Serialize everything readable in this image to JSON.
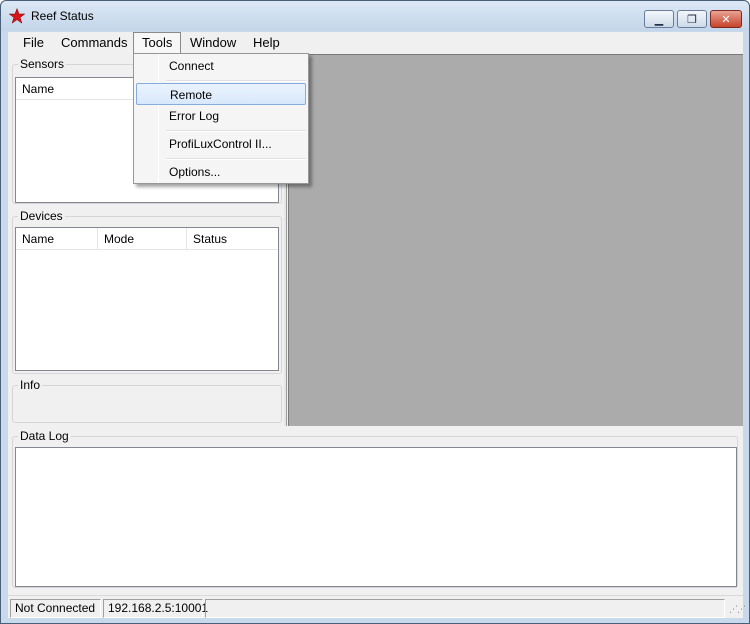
{
  "window": {
    "title": "Reef Status",
    "minimize_glyph": "▁",
    "maximize_glyph": "❐",
    "close_glyph": "✕",
    "icon": "red-star-icon",
    "icon_color": "#d7141a"
  },
  "menubar": {
    "items": [
      {
        "label": "File"
      },
      {
        "label": "Commands"
      },
      {
        "label": "Tools"
      },
      {
        "label": "Window"
      },
      {
        "label": "Help"
      }
    ]
  },
  "tools_menu": {
    "items": [
      {
        "label": "Connect"
      },
      {
        "label": "Remote",
        "highlighted": true
      },
      {
        "label": "Error Log"
      },
      {
        "label": "ProfiLuxControl II..."
      },
      {
        "label": "Options..."
      }
    ]
  },
  "sensors": {
    "title": "Sensors",
    "columns": [
      "Name"
    ]
  },
  "devices": {
    "title": "Devices",
    "columns": [
      "Name",
      "Mode",
      "Status"
    ]
  },
  "info": {
    "title": "Info"
  },
  "datalog": {
    "title": "Data Log"
  },
  "statusbar": {
    "connection": "Not Connected",
    "address": "192.168.2.5:10001",
    "extra": ""
  },
  "colors": {
    "mdi_background": "#ababab",
    "highlight": "#84acdd"
  }
}
